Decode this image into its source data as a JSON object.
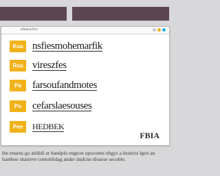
{
  "window": {
    "title": "вбмшшбоо"
  },
  "list": {
    "items": [
      {
        "tag": "Koa",
        "label": "nsfiesmohemarfik"
      },
      {
        "tag": "Roa",
        "label": "vireszfes"
      },
      {
        "tag": "Pa",
        "label": "farsoufandmotes"
      },
      {
        "tag": "Po",
        "label": "cefarslaesouses"
      },
      {
        "tag": "Pee",
        "label": "HEDBEK"
      }
    ]
  },
  "corner_label": "FBIA",
  "footer": {
    "text": "the ensens go atididi ar handplo engeon opocones uhgys a hesticts lgeit an bamboe shatieve contoblidag ander dudcnn dioarse secoble."
  },
  "colors": {
    "top_bar": "#5b4651",
    "tag": "#f1b219",
    "background": "#d8d7d9"
  }
}
